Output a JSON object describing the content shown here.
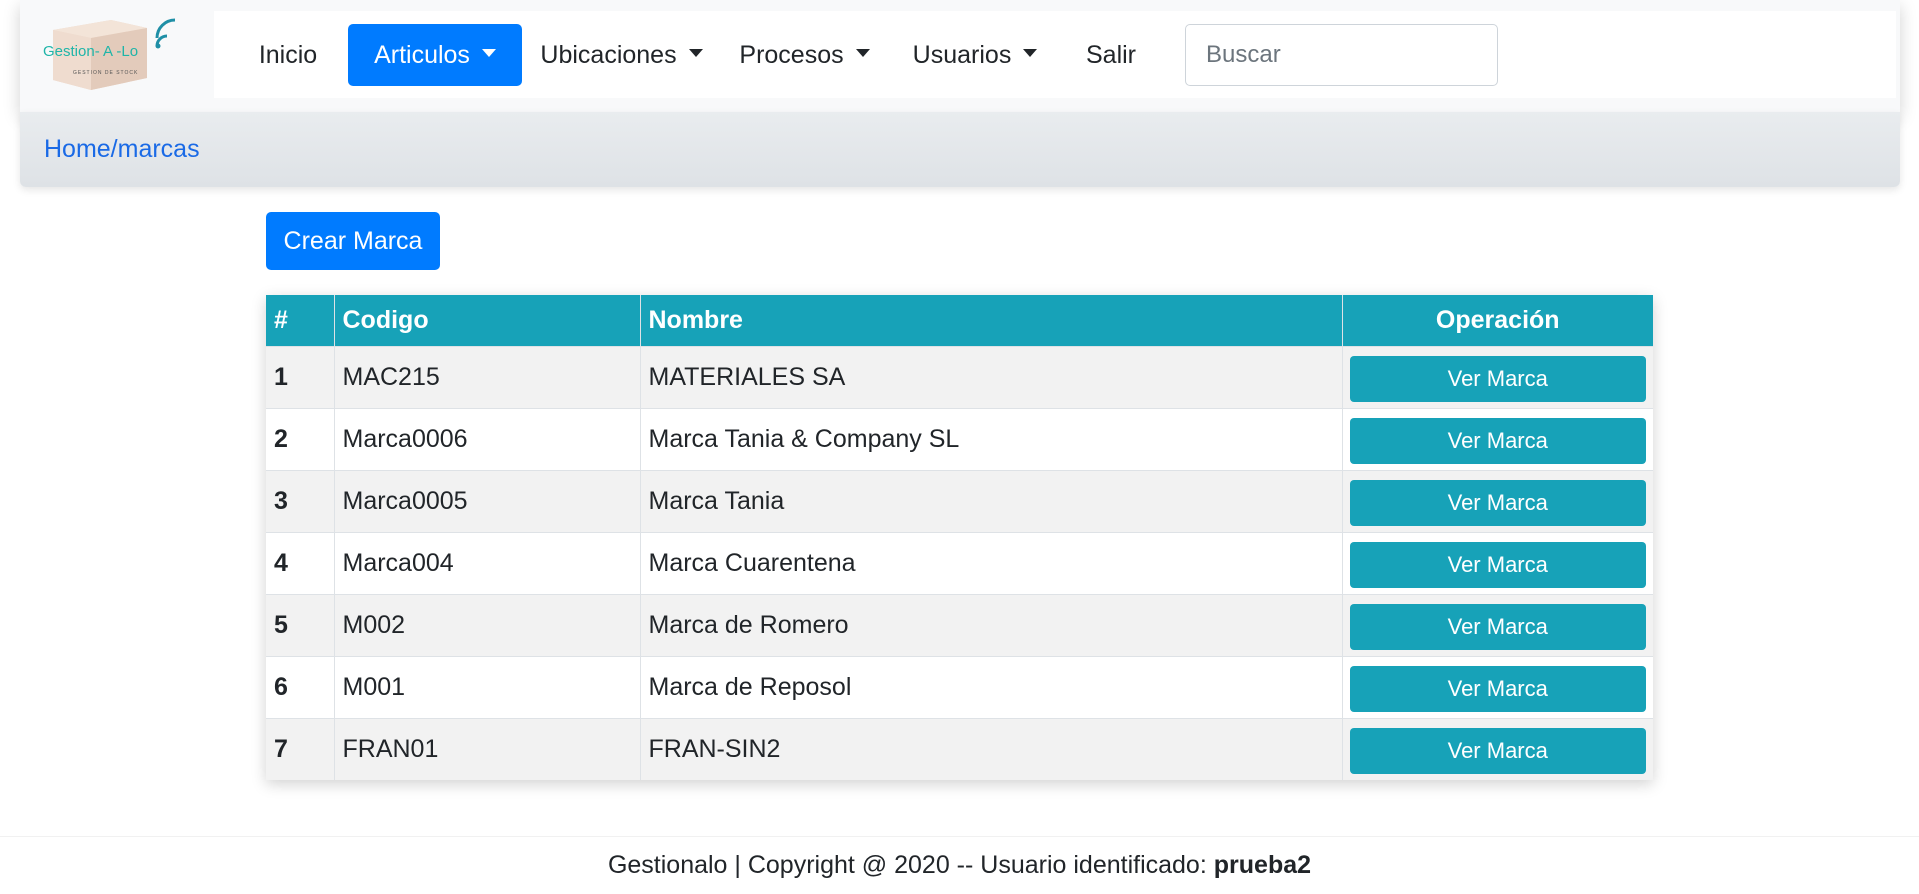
{
  "logo": {
    "text": "Gestion- A -Lo",
    "tagline": "GESTION DE STOCK"
  },
  "nav": {
    "items": [
      {
        "label": "Inicio"
      },
      {
        "label": "Articulos"
      },
      {
        "label": "Ubicaciones"
      },
      {
        "label": "Procesos"
      },
      {
        "label": "Usuarios"
      },
      {
        "label": "Salir"
      }
    ],
    "search_placeholder": "Buscar"
  },
  "breadcrumb": "Home/marcas",
  "create_button": "Crear Marca",
  "table": {
    "headers": [
      "#",
      "Codigo",
      "Nombre",
      "Operación"
    ],
    "button_label": "Ver Marca",
    "rows": [
      {
        "num": "1",
        "codigo": "MAC215",
        "nombre": "MATERIALES SA"
      },
      {
        "num": "2",
        "codigo": "Marca0006",
        "nombre": "Marca Tania & Company SL"
      },
      {
        "num": "3",
        "codigo": "Marca0005",
        "nombre": "Marca Tania"
      },
      {
        "num": "4",
        "codigo": "Marca004",
        "nombre": "Marca Cuarentena"
      },
      {
        "num": "5",
        "codigo": "M002",
        "nombre": "Marca de Romero"
      },
      {
        "num": "6",
        "codigo": "M001",
        "nombre": "Marca de Reposol"
      },
      {
        "num": "7",
        "codigo": "FRAN01",
        "nombre": "FRAN-SIN2"
      }
    ]
  },
  "footer": {
    "text": "Gestionalo | Copyright @ 2020 -- Usuario identificado:",
    "user": "prueba2"
  },
  "colors": {
    "primary": "#007bff",
    "info": "#17a2b8",
    "breadcrumb_link": "#1a6ae6"
  }
}
